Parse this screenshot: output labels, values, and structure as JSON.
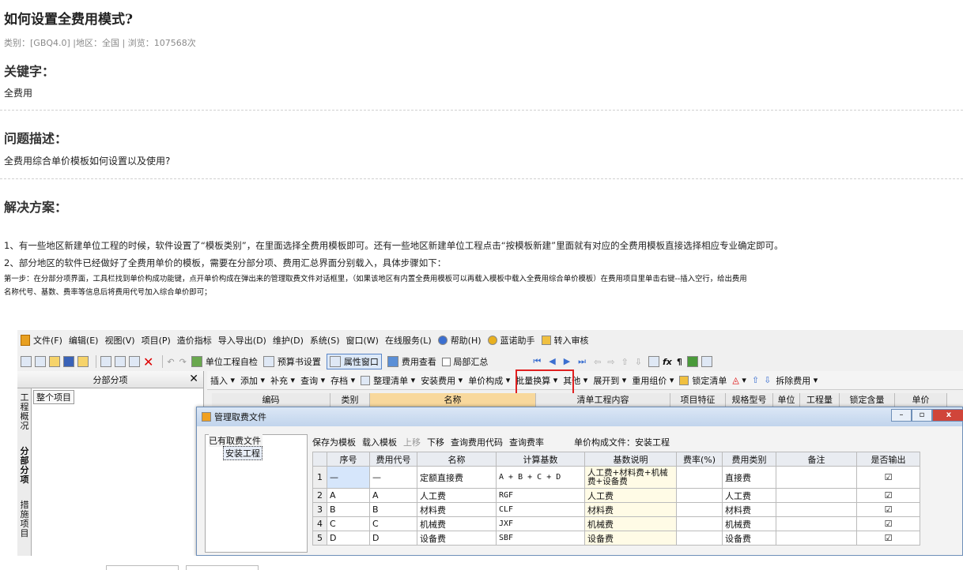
{
  "article": {
    "title": "如何设置全费用模式?",
    "meta": "类别：[GBQ4.0]  |地区：全国 |  浏览：107568次",
    "keywords_heading": "关键字：",
    "keywords": "全费用",
    "problem_heading": "问题描述：",
    "problem": "全费用综合单价模板如何设置以及使用?",
    "solution_heading": "解决方案：",
    "solution_1": "1、有一些地区新建单位工程的时候，软件设置了“模板类别”，在里面选择全费用模板即可。还有一些地区新建单位工程点击“按模板新建”里面就有对应的全费用模板直接选择相应专业确定即可。",
    "solution_2": "2、部分地区的软件已经做好了全费用单价的模板，需要在分部分项、费用汇总界面分别载入，具体步骤如下：",
    "step1_line1": "第一步：在分部分项界面，工具栏找到单价构成功能键，点开单价构成在弹出来的管理取费文件对话框里，（如果该地区有内置全费用模板可以再载入模板中载入全费用综合单价模板）在费用项目里单击右键--插入空行，给出费用",
    "step1_line2": "名称代号、基数、费率等信息后将费用代号加入综合单价即可；"
  },
  "app": {
    "menu": [
      "文件(F)",
      "编辑(E)",
      "视图(V)",
      "项目(P)",
      "造价指标",
      "导入导出(D)",
      "维护(D)",
      "系统(S)",
      "窗口(W)",
      "在线服务(L)",
      "帮助(H)",
      "蓝诺助手",
      "转入审核"
    ],
    "toolbar1": {
      "self_check": "单位工程自检",
      "budget_settings": "预算书设置",
      "property_window": "属性窗口",
      "fee_view": "费用查看",
      "partial_summary": "局部汇总"
    },
    "left_panel": {
      "title": "分部分项",
      "close": "✕",
      "tree_root": "整个项目",
      "vtabs": [
        "工程概况",
        "分部分项",
        "措施项目"
      ]
    },
    "toolbar2": [
      "插入",
      "添加",
      "补充",
      "查询",
      "存档",
      "整理清单",
      "安装费用",
      "单价构成",
      "批量换算",
      "其他",
      "展开到",
      "重用组价",
      "锁定清单",
      "拆除费用"
    ],
    "grid_headers": [
      "编码",
      "类别",
      "名称",
      "清单工程内容",
      "项目特征",
      "规格型号",
      "单位",
      "工程量",
      "锁定含量",
      "单价"
    ]
  },
  "dialog": {
    "title": "管理取费文件",
    "existing_label": "已有取费文件",
    "tree_node": "安装工程",
    "toolbar": {
      "save_template": "保存为模板",
      "load_template": "载入模板",
      "move_up": "上移",
      "move_down": "下移",
      "query_code": "查询费用代码",
      "query_rate": "查询费率",
      "file_label": "单价构成文件：安装工程"
    },
    "columns": [
      "",
      "序号",
      "费用代号",
      "名称",
      "计算基数",
      "基数说明",
      "费率(%)",
      "费用类别",
      "备注",
      "是否输出"
    ],
    "rows": [
      {
        "rn": "1",
        "no": "—",
        "code": "—",
        "name": "定额直接费",
        "base": "A + B + C + D",
        "desc": "人工费+材料费+机械费+设备费",
        "rate": "",
        "cat": "直接费",
        "note": "",
        "out": "☑"
      },
      {
        "rn": "2",
        "no": "A",
        "code": "A",
        "name": "人工费",
        "base": "RGF",
        "desc": "人工费",
        "rate": "",
        "cat": "人工费",
        "note": "",
        "out": "☑"
      },
      {
        "rn": "3",
        "no": "B",
        "code": "B",
        "name": "材料费",
        "base": "CLF",
        "desc": "材料费",
        "rate": "",
        "cat": "材料费",
        "note": "",
        "out": "☑"
      },
      {
        "rn": "4",
        "no": "C",
        "code": "C",
        "name": "机械费",
        "base": "JXF",
        "desc": "机械费",
        "rate": "",
        "cat": "机械费",
        "note": "",
        "out": "☑"
      },
      {
        "rn": "5",
        "no": "D",
        "code": "D",
        "name": "设备费",
        "base": "SBF",
        "desc": "设备费",
        "rate": "",
        "cat": "设备费",
        "note": "",
        "out": "☑"
      }
    ]
  }
}
